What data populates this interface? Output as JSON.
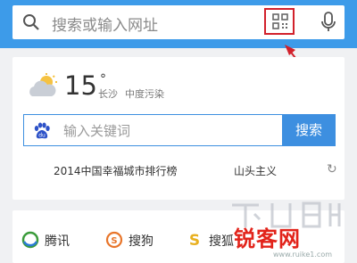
{
  "search_bar": {
    "placeholder": "搜索或输入网址"
  },
  "weather": {
    "temperature": "15",
    "unit": "°",
    "city": "长沙",
    "air_quality": "中度污染"
  },
  "baidu_search": {
    "placeholder": "输入关键词",
    "button": "搜索"
  },
  "hot_topics": [
    "2014中国幸福城市排行榜",
    "山头主义"
  ],
  "sites": [
    {
      "name": "腾讯",
      "icon": "tencent-logo-icon"
    },
    {
      "name": "搜狗",
      "icon": "sogou-logo-icon"
    },
    {
      "name": "搜狐",
      "icon": "sohu-logo-icon"
    }
  ],
  "watermark": {
    "text": "锐客网",
    "sub": "www.ruike1.com"
  },
  "colors": {
    "topbar": "#3d9be9",
    "highlight": "#d2212b",
    "baidu_blue": "#3d8fe0"
  }
}
